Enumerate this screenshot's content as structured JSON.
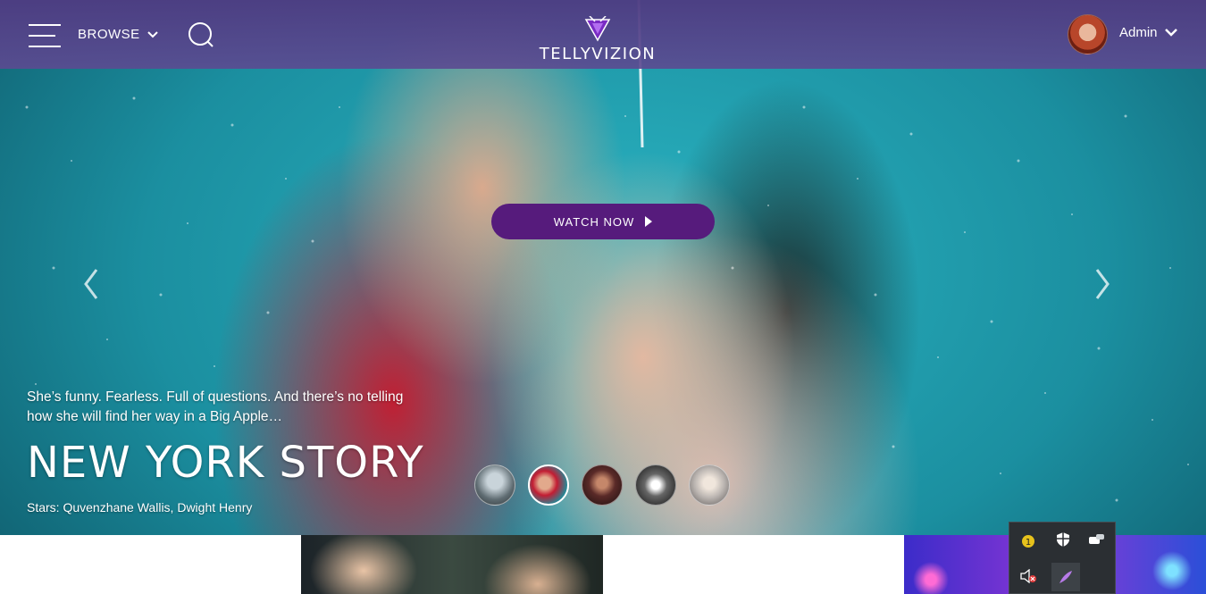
{
  "app": {
    "brand": "TELLYVIZION",
    "accent_color": "#561b7c",
    "header_color": "#4e3c82"
  },
  "header": {
    "browse_label": "BROWSE",
    "user_name": "Admin",
    "icons": [
      "menu-icon",
      "chevron-down-icon",
      "search-icon",
      "logo-icon",
      "avatar",
      "chevron-down-icon"
    ]
  },
  "hero": {
    "watch_label": "WATCH NOW",
    "description": "She’s funny. Fearless. Full of questions. And there’s no telling how she will find her way in a Big Apple…",
    "title": "NEW YORK STORY",
    "stars": "Stars: Quvenzhane Wallis, Dwight Henry",
    "carousel_count": 5,
    "active_slide": 2
  },
  "tray": {
    "icons": [
      "notification-icon",
      "shield-icon",
      "chat-icon",
      "speaker-muted-icon",
      "feather-icon"
    ],
    "notification_count": "1"
  }
}
